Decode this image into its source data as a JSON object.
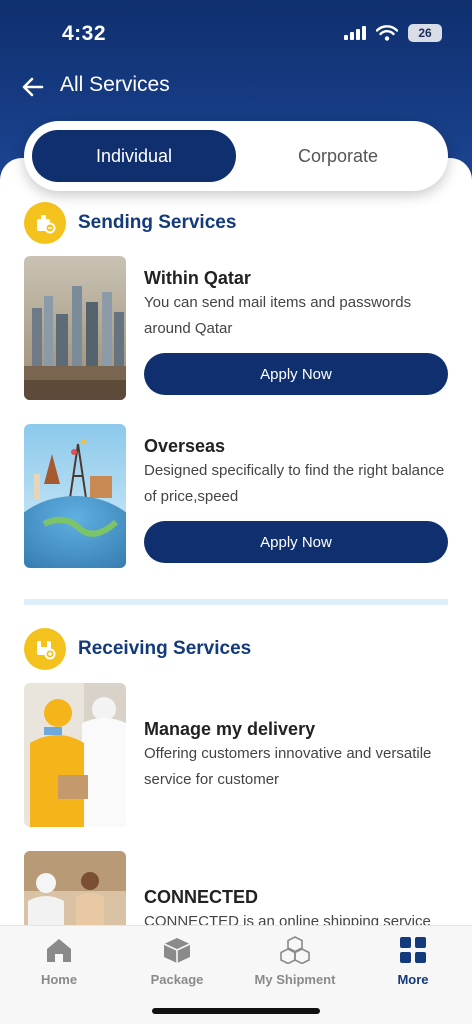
{
  "status_bar": {
    "time": "4:32",
    "battery": "26"
  },
  "header": {
    "title": "All Services",
    "back_icon": "arrow-left-icon"
  },
  "segments": {
    "individual": "Individual",
    "corporate": "Corporate",
    "selected": "Individual"
  },
  "sending": {
    "title": "Sending Services",
    "icon": "package-send-icon",
    "items": [
      {
        "title": "Within Qatar",
        "description": "You can send mail items and passwords around Qatar",
        "button": "Apply Now"
      },
      {
        "title": "Overseas",
        "description": "Designed specifically to find the right balance of price,speed",
        "button": "Apply Now"
      }
    ]
  },
  "receiving": {
    "title": "Receiving Services",
    "icon": "package-receive-icon",
    "items": [
      {
        "title": "Manage my delivery",
        "description": "Offering customers innovative and versatile service for customer"
      },
      {
        "title": "CONNECTED",
        "description": "CONNECTED is an online shipping service"
      }
    ]
  },
  "tabbar": {
    "items": [
      {
        "label": "Home",
        "icon": "home-icon"
      },
      {
        "label": "Package",
        "icon": "package-icon"
      },
      {
        "label": "My Shipment",
        "icon": "boxes-icon"
      },
      {
        "label": "More",
        "icon": "grid-icon"
      }
    ],
    "active": "More"
  },
  "colors": {
    "primary": "#0f2f6e",
    "accent": "#f4c21c",
    "section_title": "#133a7a",
    "divider": "#dfeefb"
  }
}
